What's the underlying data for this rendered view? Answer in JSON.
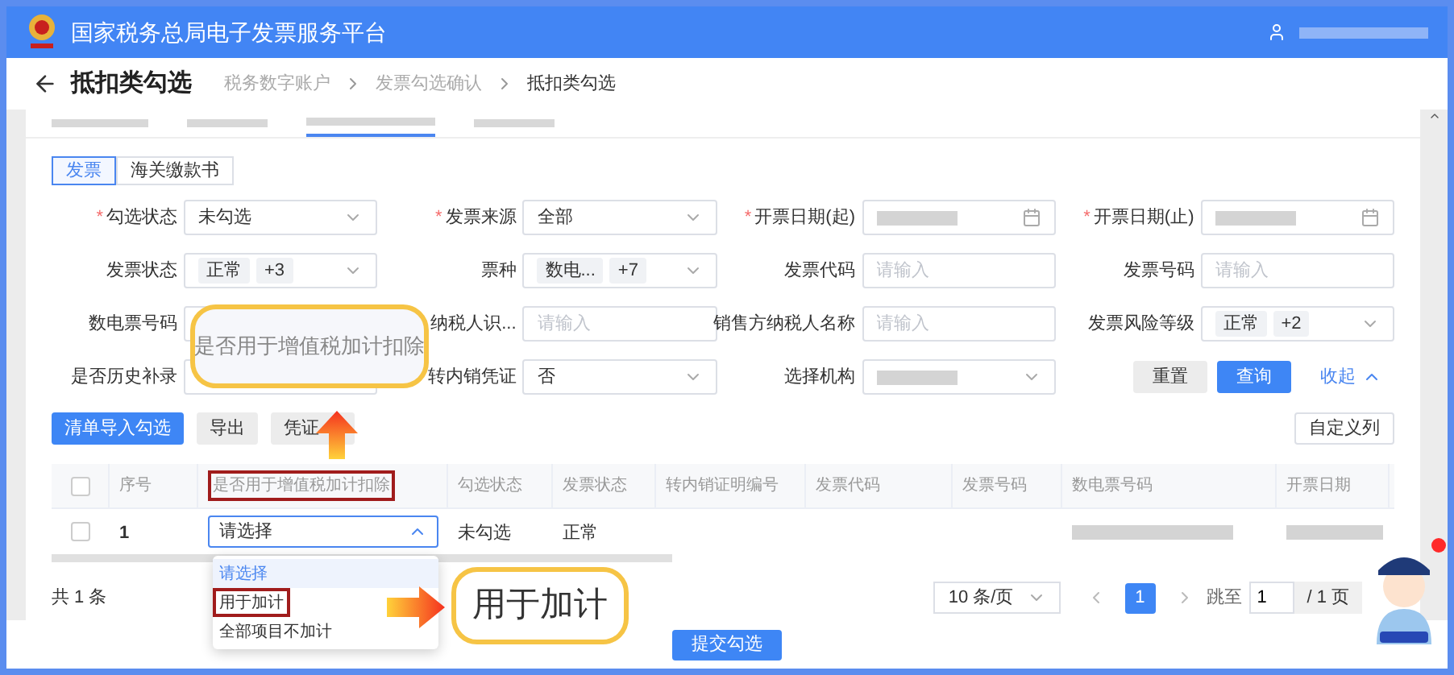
{
  "header": {
    "title": "国家税务总局电子发票服务平台"
  },
  "page": {
    "title": "抵扣类勾选",
    "breadcrumb": [
      "税务数字账户",
      "发票勾选确认",
      "抵扣类勾选"
    ]
  },
  "doc_tabs": [
    {
      "label": "发票",
      "selected": true
    },
    {
      "label": "海关缴款书",
      "selected": false
    }
  ],
  "filters": [
    {
      "kind": "select",
      "label": "勾选状态",
      "mark": "*",
      "value": "未勾选"
    },
    {
      "kind": "select",
      "label": "发票来源",
      "mark": "*",
      "value": "全部"
    },
    {
      "kind": "date",
      "label": "开票日期(起)",
      "mark": "*",
      "redacted": true
    },
    {
      "kind": "date",
      "label": "开票日期(止)",
      "mark": "*",
      "redacted": true
    },
    {
      "kind": "tags",
      "label": "发票状态",
      "tags": [
        "正常",
        "+3"
      ]
    },
    {
      "kind": "tags",
      "label": "票种",
      "tags": [
        "数电...",
        "+7"
      ]
    },
    {
      "kind": "input",
      "label": "发票代码",
      "placeholder": "请输入"
    },
    {
      "kind": "input",
      "label": "发票号码",
      "placeholder": "请输入"
    },
    {
      "kind": "input",
      "label": "数电票号码"
    },
    {
      "kind": "input",
      "label": "纳税人识...",
      "placeholder": "请输入"
    },
    {
      "kind": "input",
      "label": "销售方纳税人名称",
      "placeholder": "请输入"
    },
    {
      "kind": "tags",
      "label": "发票风险等级",
      "tags": [
        "正常",
        "+2"
      ]
    },
    {
      "kind": "input",
      "label": "是否历史补录"
    },
    {
      "kind": "select",
      "label": "转内销凭证",
      "value": "否"
    },
    {
      "kind": "select",
      "label": "选择机构",
      "redacted": true
    }
  ],
  "filter_actions": {
    "reset": "重置",
    "query": "查询",
    "collapse": "收起"
  },
  "toolbar": {
    "buttons": [
      {
        "label": "清单导入勾选",
        "primary": true
      },
      {
        "label": "导出",
        "primary": false
      },
      {
        "label": "凭证",
        "primary": false
      }
    ],
    "custom_columns": "自定义列"
  },
  "table": {
    "select_all": {
      "checked": false
    },
    "columns": [
      {
        "label": "序号",
        "highlighted": false
      },
      {
        "label": "是否用于增值税加计扣除",
        "highlighted": true
      },
      {
        "label": "勾选状态",
        "highlighted": false
      },
      {
        "label": "发票状态",
        "highlighted": false
      },
      {
        "label": "转内销证明编号",
        "highlighted": false
      },
      {
        "label": "发票代码",
        "highlighted": false
      },
      {
        "label": "发票号码",
        "highlighted": false
      },
      {
        "label": "数电票号码",
        "highlighted": false
      },
      {
        "label": "开票日期",
        "highlighted": false
      }
    ],
    "rows": [
      {
        "checked": false,
        "index": "1",
        "deduction": {
          "value": "请选择",
          "open": true
        },
        "check_status": "未勾选",
        "invoice_status": "正常"
      }
    ]
  },
  "dropdown_options": [
    {
      "label": "请选择",
      "selected": true,
      "highlighted": false
    },
    {
      "label": "用于加计",
      "selected": false,
      "highlighted": true
    },
    {
      "label": "全部项目不加计",
      "selected": false,
      "highlighted": false
    }
  ],
  "footer": {
    "total": "共 1 条",
    "page_size": "10 条/页",
    "pages": [
      {
        "label": "1",
        "selected": true
      }
    ],
    "jump_label": "跳至",
    "jump_value": "1",
    "total_pages": "/ 1 页"
  },
  "submit": "提交勾选",
  "annotations": [
    {
      "text": "是否用于增值税加计扣除"
    },
    {
      "text": "用于加计"
    }
  ]
}
